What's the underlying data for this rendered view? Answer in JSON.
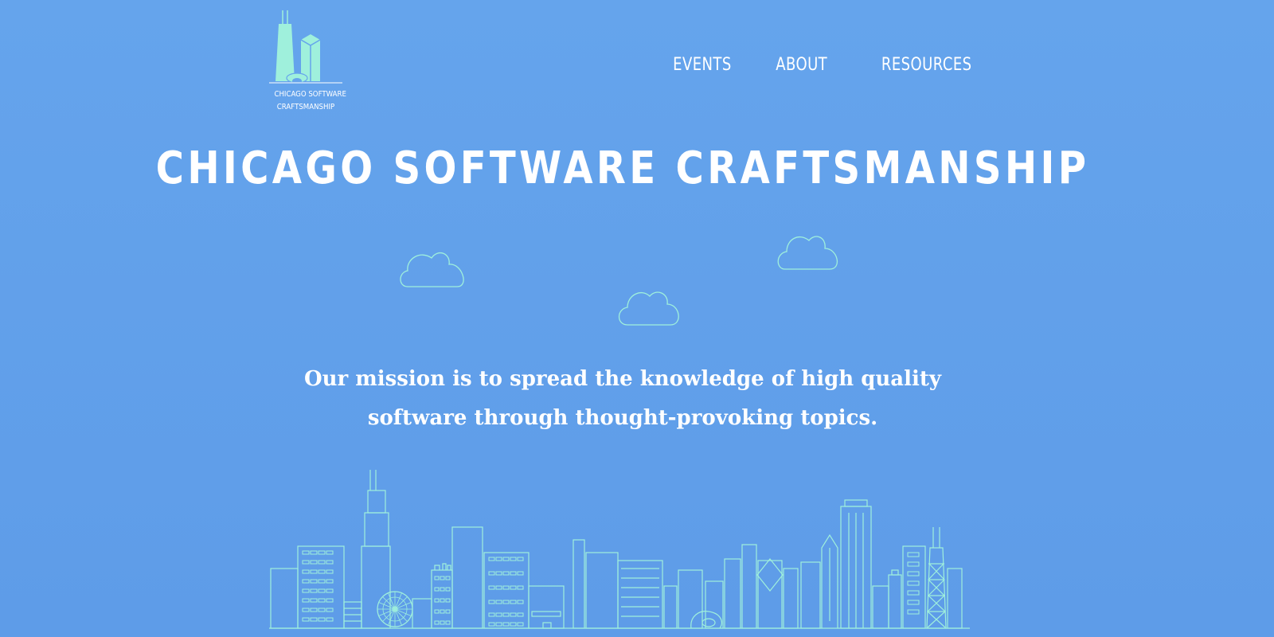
{
  "brand": {
    "logo_line1": "CHICAGO SOFTWARE",
    "logo_line2": "CRAFTSMANSHIP"
  },
  "nav": {
    "items": [
      {
        "label": "EVENTS"
      },
      {
        "label": "ABOUT"
      },
      {
        "label": "RESOURCES"
      }
    ]
  },
  "hero": {
    "title": "CHICAGO SOFTWARE CRAFTSMANSHIP",
    "mission": "Our mission is to spread the knowledge of high quality software through thought-provoking topics."
  },
  "colors": {
    "background": "#62a0ea",
    "line_art": "#9ff0dc",
    "logo_fill": "#9ff0dc",
    "text": "#ffffff"
  },
  "icons": {
    "logo": "chicago-skyline-logo-icon",
    "clouds": "cloud-icon",
    "skyline": "chicago-skyline-illustration"
  }
}
